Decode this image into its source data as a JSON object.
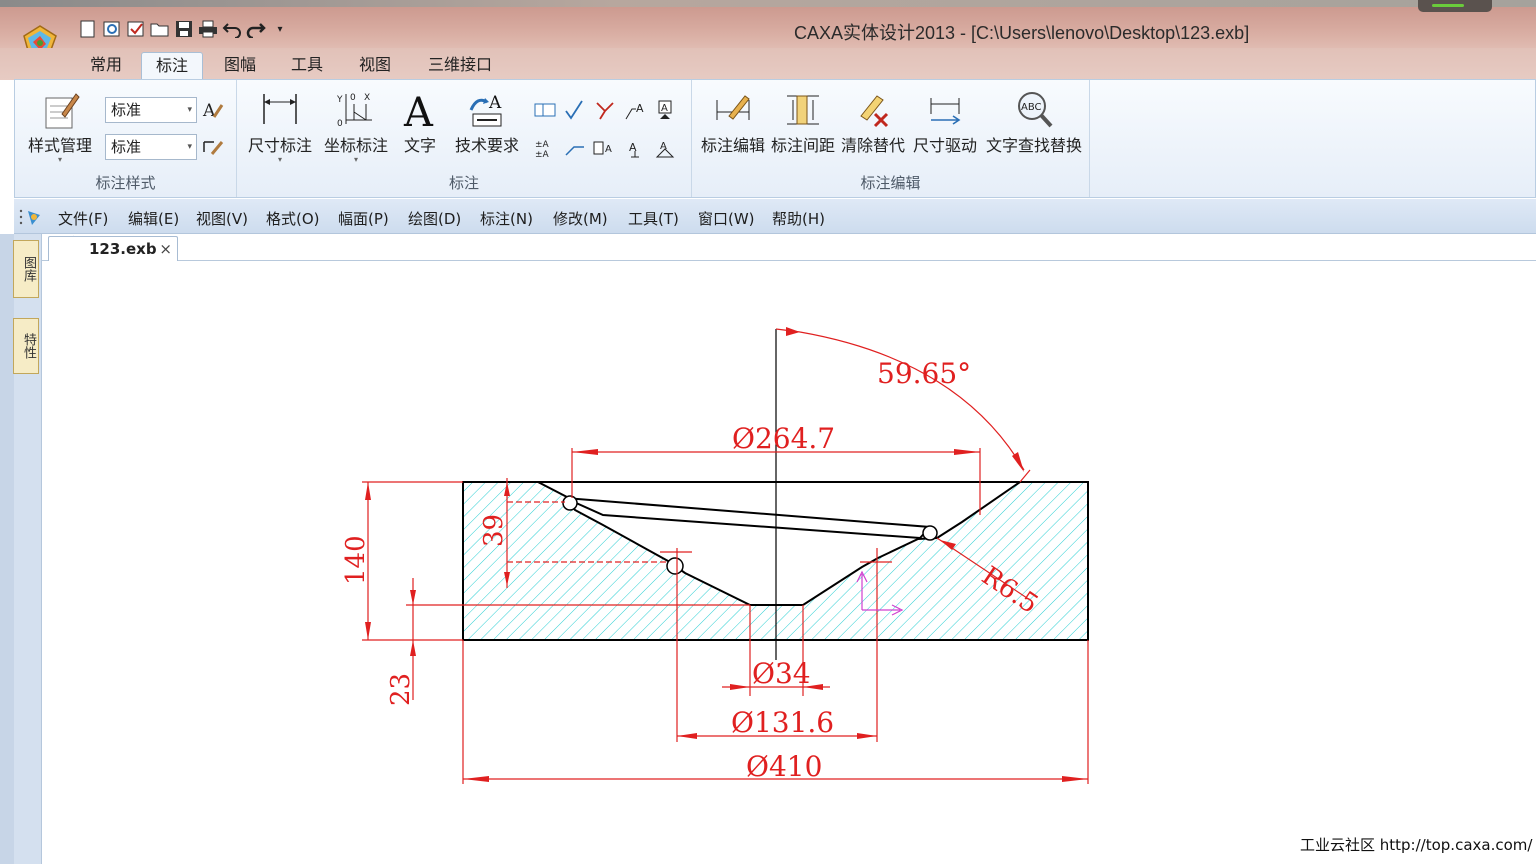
{
  "window": {
    "title": "CAXA实体设计2013 - [C:\\Users\\lenovo\\Desktop\\123.exb]"
  },
  "quick_access": {
    "icons": [
      "new-file-icon",
      "open-template-icon",
      "check-icon",
      "open-folder-icon",
      "save-icon",
      "print-icon",
      "undo-icon",
      "redo-icon",
      "customize-icon"
    ]
  },
  "ribbon_tabs": [
    "常用",
    "标注",
    "图幅",
    "工具",
    "视图",
    "三维接口"
  ],
  "active_tab": "标注",
  "ribbon": {
    "style_group": {
      "label": "标注样式",
      "style_manager": "样式管理",
      "combo_text_style": "标准",
      "combo_dim_style": "标准"
    },
    "annotate_group": {
      "label": "标注",
      "dimension": "尺寸标注",
      "coordinate": "坐标标注",
      "text": "文字",
      "tech_req": "技术要求"
    },
    "edit_group": {
      "label": "标注编辑",
      "edit": "标注编辑",
      "spacing": "标注间距",
      "clear_replace": "清除替代",
      "dim_drive": "尺寸驱动",
      "find_replace": "文字查找替换"
    }
  },
  "menubar": [
    "文件(F)",
    "编辑(E)",
    "视图(V)",
    "格式(O)",
    "幅面(P)",
    "绘图(D)",
    "标注(N)",
    "修改(M)",
    "工具(T)",
    "窗口(W)",
    "帮助(H)"
  ],
  "side_tabs": [
    "图库",
    "特性"
  ],
  "document_tab": {
    "label": "123.exb",
    "close": "×"
  },
  "drawing": {
    "dimensions": {
      "angle": "59.65°",
      "top_dia": "Ø264.7",
      "height_140": "140",
      "height_39": "39",
      "radius": "R6.5",
      "dia_34": "Ø34",
      "dia_131": "Ø131.6",
      "dia_410": "Ø410",
      "height_23": "23"
    },
    "colors": {
      "dimension": "#e02020",
      "hatch": "#2bcfd3",
      "outline": "#000000",
      "ucs": "#d040d0"
    }
  },
  "footer": "工业云社区 http://top.caxa.com/"
}
